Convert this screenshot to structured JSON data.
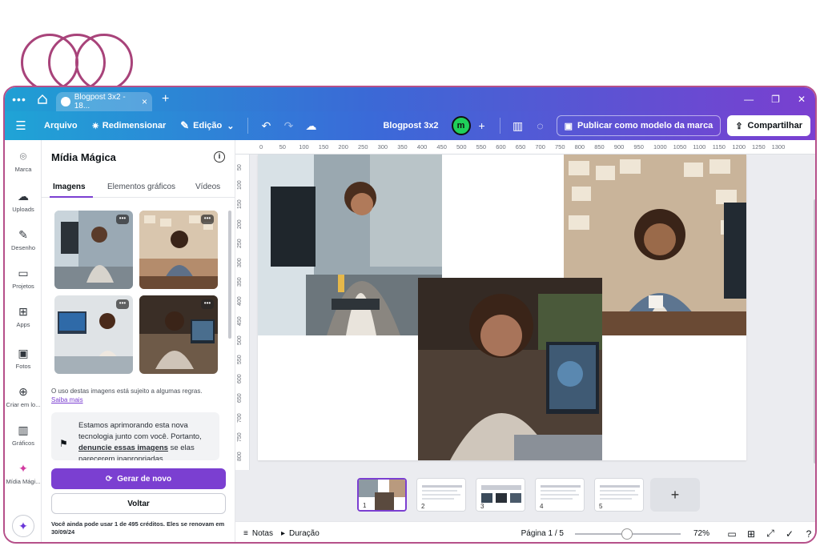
{
  "tabbar": {
    "menu_glyph": "•••",
    "tab_title": "Blogpost 3x2 - 18...",
    "tab_close": "×",
    "new_tab": "+",
    "win_min": "—",
    "win_max": "❐",
    "win_close": "✕"
  },
  "toolbar": {
    "menu_glyph": "☰",
    "file": "Arquivo",
    "resize": "Redimensionar",
    "edit": "Edição",
    "doc_name": "Blogpost 3x2",
    "magic_badge": "m",
    "add": "+",
    "publish": "Publicar como modelo da marca",
    "share": "Compartilhar"
  },
  "rail": [
    {
      "label": "Marca",
      "icon": "brand-icon",
      "glyph": "⌾"
    },
    {
      "label": "Uploads",
      "icon": "upload-cloud-icon",
      "glyph": "☁"
    },
    {
      "label": "Desenho",
      "icon": "pen-icon",
      "glyph": "✎"
    },
    {
      "label": "Projetos",
      "icon": "folder-icon",
      "glyph": "▭"
    },
    {
      "label": "Apps",
      "icon": "apps-icon",
      "glyph": "⊞"
    },
    {
      "label": "Fotos",
      "icon": "photo-icon",
      "glyph": "▣"
    },
    {
      "label": "Criar em lo...",
      "icon": "create-plus-icon",
      "glyph": "⊕"
    },
    {
      "label": "Gráficos",
      "icon": "chart-icon",
      "glyph": "▥"
    },
    {
      "label": "Mídia Mági...",
      "icon": "magic-media-icon",
      "glyph": "✦"
    }
  ],
  "panel": {
    "title": "Mídia Mágica",
    "info": "i",
    "tabs": [
      "Imagens",
      "Elementos gráficos",
      "Vídeos"
    ],
    "more": "•••",
    "rules_text": "O uso destas imagens está sujeito a algumas regras.",
    "rules_link": "Saiba mais",
    "note_prefix": "Estamos aprimorando esta nova tecnologia junto com você. Portanto,",
    "note_link": "denuncie essas imagens",
    "note_suffix": "se elas parecerem inapropriadas.",
    "regenerate": "Gerar de novo",
    "back": "Voltar",
    "credits": "Você ainda pode usar 1 de 495 créditos. Eles se renovam em 30/09/24"
  },
  "ruler": {
    "top": [
      "0",
      "50",
      "100",
      "150",
      "200",
      "250",
      "300",
      "350",
      "400",
      "450",
      "500",
      "550",
      "600",
      "650",
      "700",
      "750",
      "800",
      "850",
      "900",
      "950",
      "1000",
      "1050",
      "1100",
      "1150",
      "1200",
      "1250",
      "1300"
    ],
    "left": [
      "50",
      "100",
      "150",
      "200",
      "250",
      "300",
      "350",
      "400",
      "450",
      "500",
      "550",
      "600",
      "650",
      "700",
      "750",
      "800"
    ]
  },
  "filmstrip": {
    "pages": [
      "1",
      "2",
      "3",
      "4",
      "5"
    ],
    "add": "+"
  },
  "status": {
    "notes": "Notas",
    "duration": "Duração",
    "page_indicator": "Página 1 / 5",
    "zoom": "72%",
    "zoom_fraction": 0.49
  },
  "colors": {
    "accent": "#7b3fd1",
    "ring": "#a8437a"
  }
}
